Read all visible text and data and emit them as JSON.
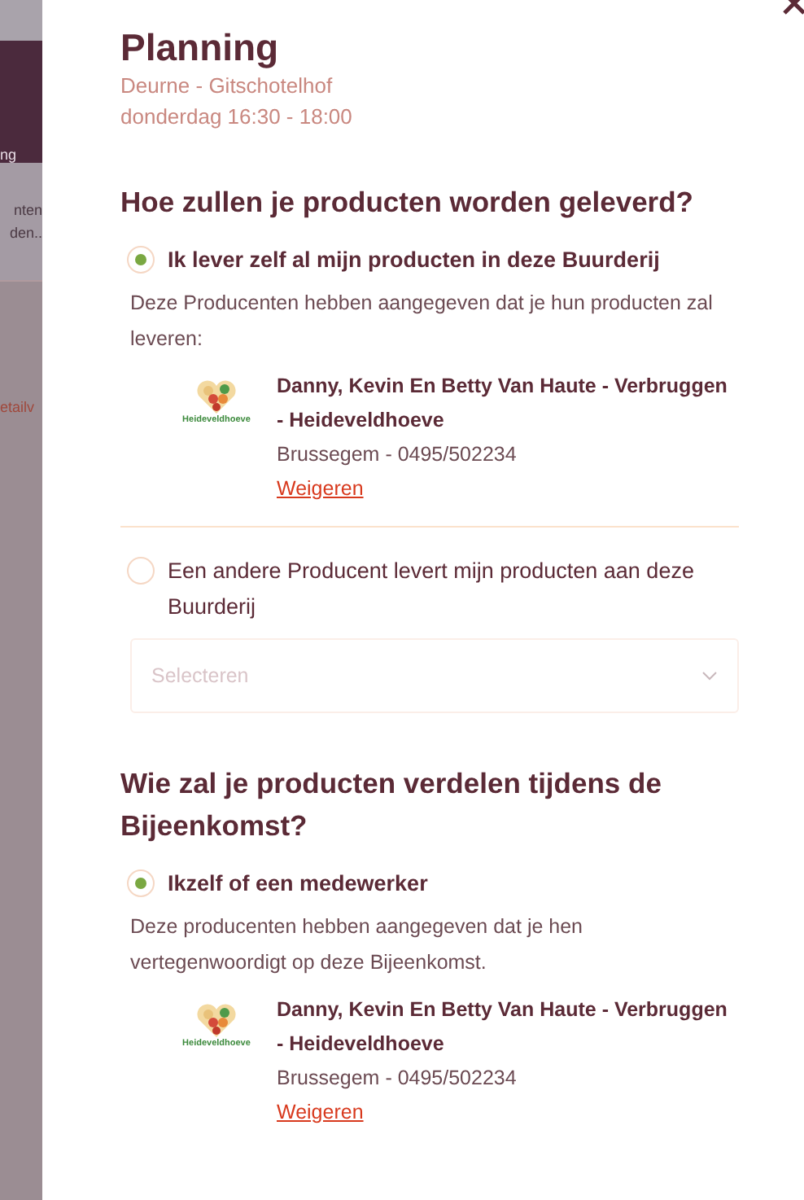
{
  "background_page": {
    "texts": [
      "ng",
      "nten",
      "den..",
      "etailv"
    ]
  },
  "panel": {
    "title": "Planning",
    "location": "Deurne - Gitschotelhof",
    "time": "donderdag 16:30 - 18:00"
  },
  "sections": [
    {
      "heading": "Hoe zullen je producten worden geleverd?",
      "options": [
        {
          "label": "Ik lever zelf al mijn producten in deze Buurderij",
          "selected": true,
          "description": "Deze Producenten hebben aangegeven dat je hun producten zal leveren:",
          "producers": [
            {
              "logo_text": "Heideveldhoeve",
              "name": "Danny, Kevin En Betty Van Haute - Verbruggen - Heideveldhoeve",
              "contact": "Brussegem - 0495/502234",
              "action": "Weigeren"
            }
          ]
        },
        {
          "label": "Een andere Producent levert mijn producten aan deze Buurderij",
          "selected": false,
          "select": {
            "placeholder": "Selecteren"
          }
        }
      ]
    },
    {
      "heading": "Wie zal je producten verdelen tijdens de Bijeenkomst?",
      "options": [
        {
          "label": "Ikzelf of een medewerker",
          "selected": true,
          "description": "Deze producenten hebben aangegeven dat je hen vertegenwoordigt op deze Bijeenkomst.",
          "producers": [
            {
              "logo_text": "Heideveldhoeve",
              "name": "Danny, Kevin En Betty Van Haute - Verbruggen - Heideveldhoeve",
              "contact": "Brussegem - 0495/502234",
              "action": "Weigeren"
            }
          ]
        }
      ]
    }
  ]
}
